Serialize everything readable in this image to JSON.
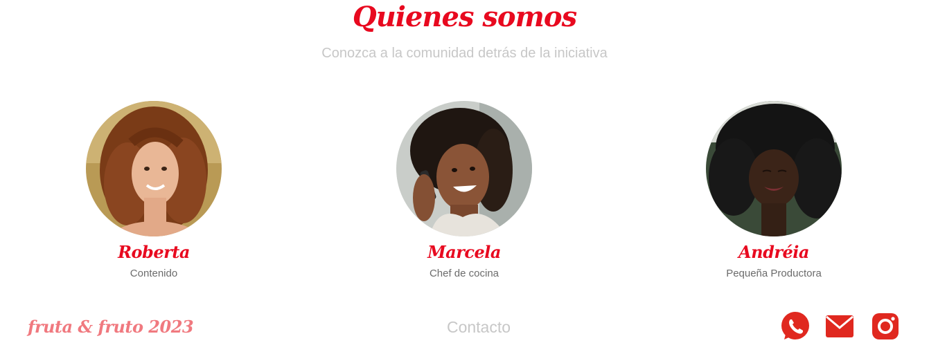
{
  "section": {
    "title": "Quienes somos",
    "subtitle": "Conozca a la comunidad detrás de la iniciativa"
  },
  "members": [
    {
      "name": "Roberta",
      "role": "Contenido"
    },
    {
      "name": "Marcela",
      "role": "Chef de cocina"
    },
    {
      "name": "Andréia",
      "role": "Pequeña Productora"
    }
  ],
  "footer": {
    "brand": "fruta & fruto 2023",
    "contact": "Contacto",
    "social_icons": [
      "whatsapp-icon",
      "mail-icon",
      "instagram-icon"
    ]
  },
  "colors": {
    "accent": "#e8091f",
    "brand_pink": "#f0797f",
    "muted": "#c7c7c7",
    "icon_red": "#e0281f"
  }
}
